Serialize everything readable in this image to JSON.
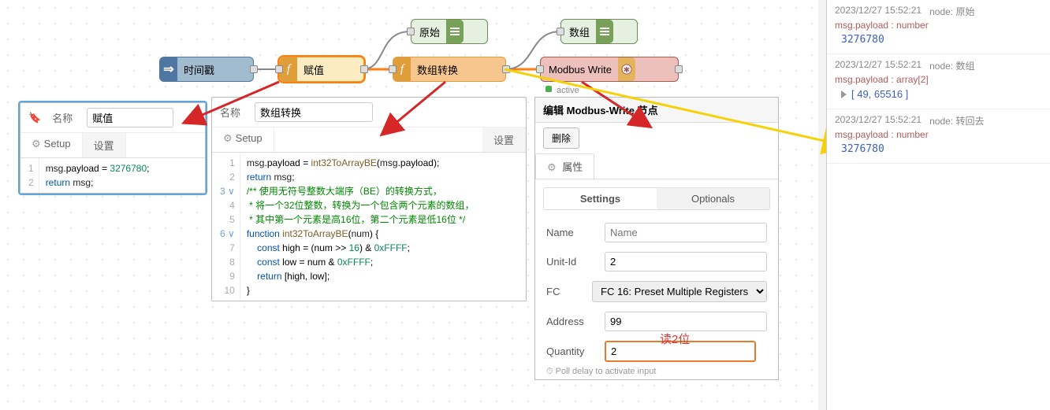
{
  "nodes": {
    "debug_raw": {
      "label": "原始"
    },
    "debug_arr": {
      "label": "数组"
    },
    "inject": {
      "label": "时间戳"
    },
    "fn1": {
      "label": "赋值"
    },
    "fn2": {
      "label": "数组转换"
    },
    "modbus": {
      "label": "Modbus Write",
      "status_label": "active"
    }
  },
  "panel1": {
    "name_label": "名称",
    "name_value": "赋值",
    "tab_setup": "Setup",
    "tab_settings": "设置",
    "code": {
      "l1": "msg.payload = 3276780;",
      "l2": "return msg;"
    }
  },
  "panel2": {
    "name_label": "名称",
    "name_value": "数组转换",
    "tab_setup": "Setup",
    "tab_settings": "设置",
    "code": {
      "l1": "msg.payload = int32ToArrayBE(msg.payload);",
      "l2": "return msg;",
      "l3": "/** 使用无符号整数大端序（BE）的转换方式，",
      "l4": " * 将一个32位整数，转换为一个包含两个元素的数组，",
      "l5": " * 其中第一个元素是高16位，第二个元素是低16位 */",
      "l6": "function int32ToArrayBE(num) {",
      "l7": "    const high = (num >> 16) & 0xFFFF;",
      "l8": "    const low = num & 0xFFFF;",
      "l9": "    return [high, low];",
      "l10": "}"
    }
  },
  "dialog": {
    "title": "编辑 Modbus-Write 节点",
    "delete_btn": "删除",
    "tab_props": "属性",
    "sub_settings": "Settings",
    "sub_optionals": "Optionals",
    "fields": {
      "name_lbl": "Name",
      "name_ph": "Name",
      "unit_lbl": "Unit-Id",
      "unit_val": "2",
      "fc_lbl": "FC",
      "fc_val": "FC 16: Preset Multiple Registers",
      "addr_lbl": "Address",
      "addr_val": "99",
      "qty_lbl": "Quantity",
      "qty_val": "2"
    },
    "read2": "读2位",
    "polldelay": "Poll delay to activate input"
  },
  "debug": {
    "e1": {
      "ts": "2023/12/27 15:52:21",
      "node": "node: 原始",
      "type": "msg.payload : number",
      "val": "3276780"
    },
    "e2": {
      "ts": "2023/12/27 15:52:21",
      "node": "node: 数组",
      "type": "msg.payload : array[2]",
      "val": "[ 49, 65516 ]"
    },
    "e3": {
      "ts": "2023/12/27 15:52:21",
      "node": "node: 转回去",
      "type": "msg.payload : number",
      "val": "3276780"
    }
  }
}
